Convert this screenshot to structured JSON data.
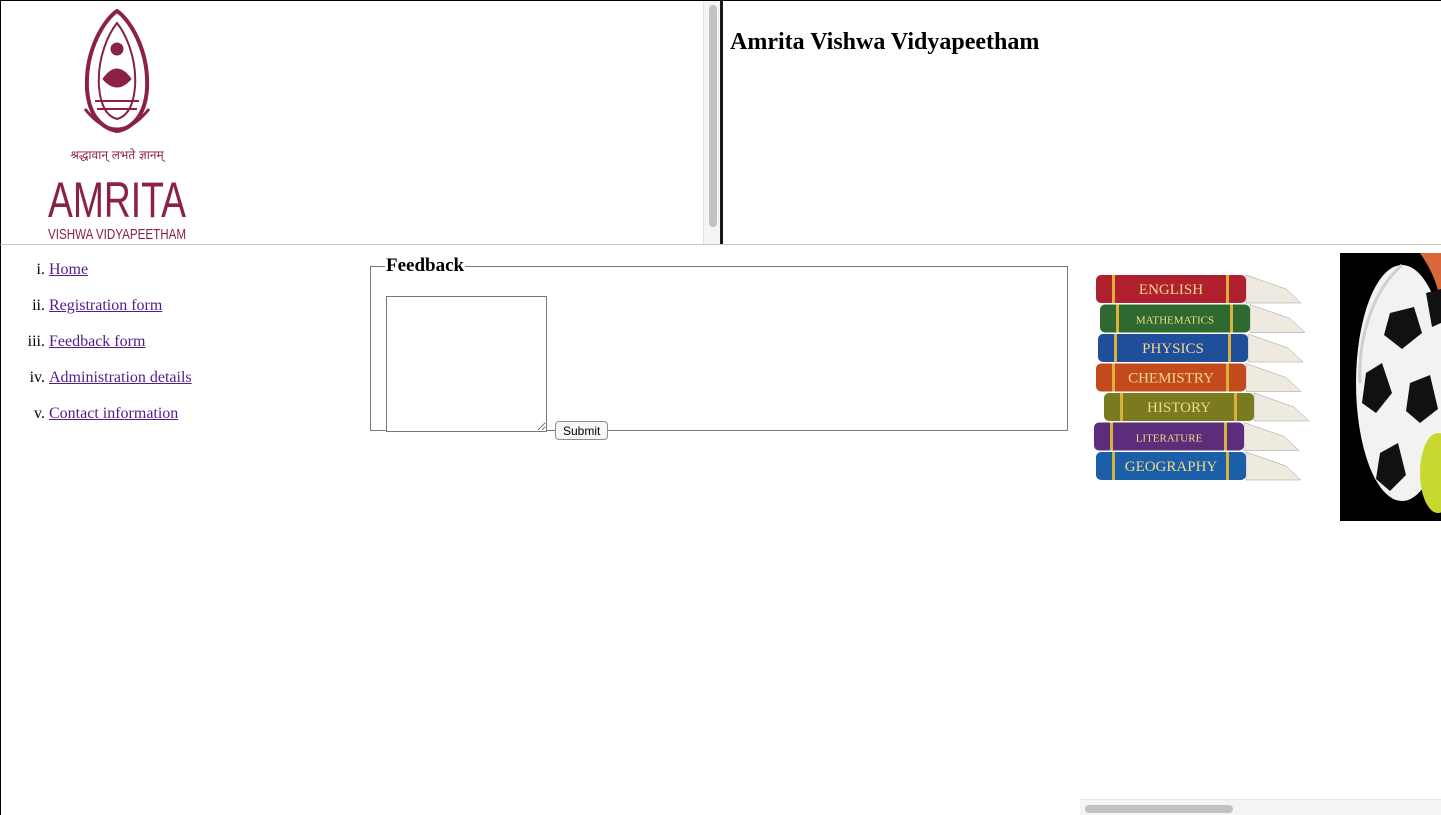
{
  "header": {
    "title": "Amrita Vishwa Vidyapeetham",
    "logo_text": "AMRITA",
    "logo_subtext": "VISHWA VIDYAPEETHAM",
    "logo_motto": "श्रद्धावान् लभते ज्ञानम्",
    "logo_color": "#8b2144"
  },
  "nav": {
    "items": [
      {
        "label": "Home"
      },
      {
        "label": "Registration form"
      },
      {
        "label": "Feedback form"
      },
      {
        "label": "Administration details"
      },
      {
        "label": "Contact information"
      }
    ],
    "link_color": "#551a8b"
  },
  "feedback": {
    "legend": "Feedback",
    "textarea_value": "",
    "submit_label": "Submit"
  },
  "sidebar": {
    "books": [
      "ENGLISH",
      "MATHEMATICS",
      "PHYSICS",
      "CHEMISTRY",
      "HISTORY",
      "LITERATURE",
      "GEOGRAPHY"
    ],
    "book_colors": [
      "#b1202f",
      "#2e6a2f",
      "#1f4f9a",
      "#c24a1c",
      "#7a7a1e",
      "#5b2d7a",
      "#1b5fa8"
    ],
    "sports_image": "soccer-ball-icon"
  }
}
